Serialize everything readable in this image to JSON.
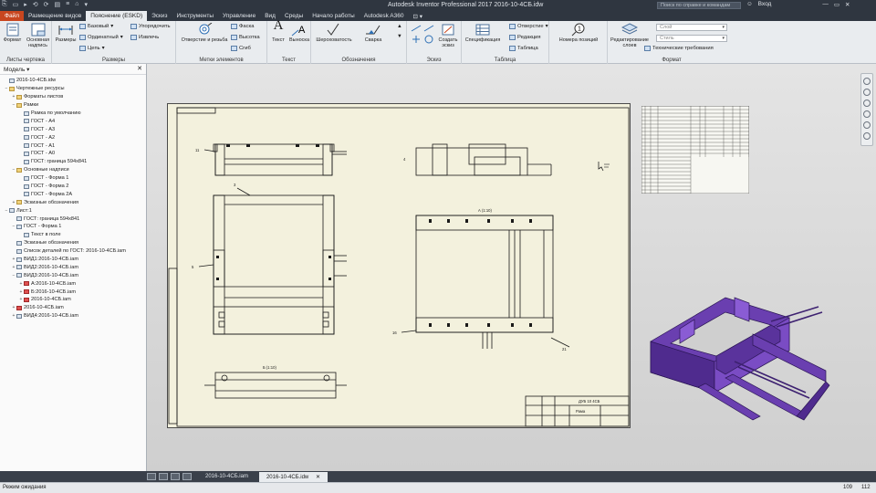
{
  "window": {
    "title": "Autodesk Inventor Professional 2017   2016-10-4СБ.idw",
    "search_placeholder": "Поиск по справке и командам",
    "user": "Вход",
    "quick_access": [
      "⎘",
      "▭",
      "▸",
      "⟲",
      "⟳",
      "▤",
      "≡",
      "⌂",
      "▾"
    ]
  },
  "ribbon_tabs": [
    "Файл",
    "Размещение видов",
    "Пояснение (ESKD)",
    "Эскиз",
    "Инструменты",
    "Управление",
    "Вид",
    "Среды",
    "Начало работы",
    "Autodesk A360",
    "⊡ ▾"
  ],
  "ribbon": {
    "sheets": {
      "label": "Листы чертежа",
      "format": "Формат",
      "title_block": "Основная надпись"
    },
    "dimensions": {
      "label": "Размеры",
      "dims": "Размеры",
      "base": "Базовый",
      "ordinate": "Ординатный",
      "chain": "Цепь",
      "arrange": "Упорядочить",
      "retrieve": "Извлечь"
    },
    "features": {
      "label": "Метки элементов",
      "hole": "Отверстие и резьба",
      "chamfer": "Фаска",
      "height": "Высотка",
      "bend": "Сгиб"
    },
    "text": {
      "label": "Текст",
      "text": "Текст",
      "leader": "Выноска"
    },
    "symbols": {
      "label": "Обозначения",
      "roughness": "Шероховатость",
      "weld": "Сварка"
    },
    "sketch": {
      "label": "Эскиз",
      "create": "Создать эскиз"
    },
    "table": {
      "label": "Таблица",
      "spec": "Спецификация",
      "holes": "Отверстие",
      "revision": "Редакция",
      "table": "Таблица"
    },
    "position": {
      "balloon": "Номера позиций"
    },
    "format": {
      "label": "Формат",
      "edit_layers": "Редактирование слоев",
      "layer_placeholder": "Слой",
      "style_placeholder": "Стиль",
      "tech_req": "Технические требования"
    }
  },
  "browser": {
    "title": "Модель ▾",
    "close": "✕",
    "nodes": [
      {
        "depth": 0,
        "toggle": "",
        "icon": "file",
        "label": "2016-10-4СБ.idw"
      },
      {
        "depth": 0,
        "toggle": "−",
        "icon": "folder",
        "label": "Чертежные ресурсы"
      },
      {
        "depth": 1,
        "toggle": "+",
        "icon": "folder",
        "label": "Форматы листов"
      },
      {
        "depth": 1,
        "toggle": "−",
        "icon": "folder",
        "label": "Рамки"
      },
      {
        "depth": 2,
        "toggle": "",
        "icon": "doc",
        "label": "Рамка по умолчанию"
      },
      {
        "depth": 2,
        "toggle": "",
        "icon": "doc",
        "label": "ГОСТ - А4"
      },
      {
        "depth": 2,
        "toggle": "",
        "icon": "doc",
        "label": "ГОСТ - А3"
      },
      {
        "depth": 2,
        "toggle": "",
        "icon": "doc",
        "label": "ГОСТ - А2"
      },
      {
        "depth": 2,
        "toggle": "",
        "icon": "doc",
        "label": "ГОСТ - А1"
      },
      {
        "depth": 2,
        "toggle": "",
        "icon": "doc",
        "label": "ГОСТ - А0"
      },
      {
        "depth": 2,
        "toggle": "",
        "icon": "doc",
        "label": "ГОСТ: граница 594х841"
      },
      {
        "depth": 1,
        "toggle": "−",
        "icon": "folder",
        "label": "Основные надписи"
      },
      {
        "depth": 2,
        "toggle": "",
        "icon": "doc",
        "label": "ГОСТ - Форма 1"
      },
      {
        "depth": 2,
        "toggle": "",
        "icon": "doc",
        "label": "ГОСТ - Форма 2"
      },
      {
        "depth": 2,
        "toggle": "",
        "icon": "doc",
        "label": "ГОСТ - Форма 2А"
      },
      {
        "depth": 1,
        "toggle": "+",
        "icon": "folder",
        "label": "Эскизные обозначения"
      },
      {
        "depth": 0,
        "toggle": "−",
        "icon": "doc",
        "label": "Лист:1"
      },
      {
        "depth": 1,
        "toggle": "",
        "icon": "doc",
        "label": "ГОСТ: граница 594х841"
      },
      {
        "depth": 1,
        "toggle": "−",
        "icon": "doc",
        "label": "ГОСТ - Форма 1"
      },
      {
        "depth": 2,
        "toggle": "",
        "icon": "doc",
        "label": "Текст в поле"
      },
      {
        "depth": 1,
        "toggle": "",
        "icon": "doc",
        "label": "Эскизные обозначения"
      },
      {
        "depth": 1,
        "toggle": "",
        "icon": "doc",
        "label": "Список деталей по ГОСТ: 2016-10-4СБ.iam"
      },
      {
        "depth": 1,
        "toggle": "+",
        "icon": "doc",
        "label": "ВИД1:2016-10-4СБ.iam"
      },
      {
        "depth": 1,
        "toggle": "+",
        "icon": "doc",
        "label": "ВИД2:2016-10-4СБ.iam"
      },
      {
        "depth": 1,
        "toggle": "−",
        "icon": "doc",
        "label": "ВИД3:2016-10-4СБ.iam"
      },
      {
        "depth": 2,
        "toggle": "+",
        "icon": "red",
        "label": "А:2016-10-4СБ.iam"
      },
      {
        "depth": 2,
        "toggle": "+",
        "icon": "red",
        "label": "Б:2016-10-4СБ.iam"
      },
      {
        "depth": 2,
        "toggle": "+",
        "icon": "red",
        "label": "2016-10-4СБ.iam"
      },
      {
        "depth": 1,
        "toggle": "+",
        "icon": "red",
        "label": "2016-10-4СБ.iam"
      },
      {
        "depth": 1,
        "toggle": "+",
        "icon": "doc",
        "label": "ВИД4:2016-10-4СБ.iam"
      }
    ]
  },
  "drawing": {
    "stamp_code": "ДУБ 10 4СБ",
    "stamp_title": "Рама",
    "view_label_a": "А (1:10)",
    "view_label_b": "Б (1:10)",
    "balloons": [
      "11",
      "5",
      "3",
      "16",
      "21",
      "4"
    ]
  },
  "doc_tabs": [
    "2016-10-4СБ.iam",
    "2016-10-4СБ.idw"
  ],
  "doc_tab_close": "✕",
  "status": {
    "text": "Режим ожидания",
    "n1": "109",
    "n2": "112"
  },
  "colors": {
    "model": "#6a3fb0",
    "model_dark": "#3d2170",
    "sheet": "#f3f1dd",
    "file_tab": "#c8461f"
  }
}
